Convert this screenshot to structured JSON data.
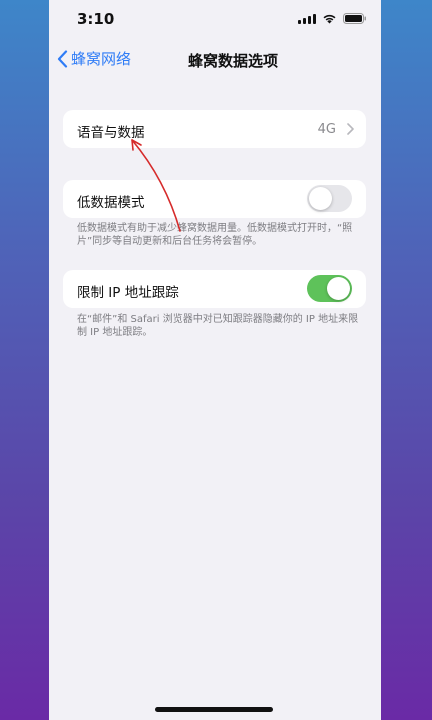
{
  "status_bar": {
    "time": "3:10"
  },
  "nav": {
    "back_label": "蜂窝网络",
    "title": "蜂窝数据选项"
  },
  "voice_data": {
    "label": "语音与数据",
    "value": "4G"
  },
  "low_data_mode": {
    "label": "低数据模式",
    "enabled": false,
    "footnote": "低数据模式有助于减少蜂窝数据用量。低数据模式打开时，“照片”同步等自动更新和后台任务将会暂停。"
  },
  "limit_ip_tracking": {
    "label": "限制 IP 地址跟踪",
    "enabled": true,
    "footnote": "在“邮件”和 Safari 浏览器中对已知跟踪器隐藏你的 IP 地址来限制 IP 地址跟踪。"
  },
  "colors": {
    "accent": "#2f7cf6",
    "toggle_on": "#5ec25a",
    "annotation": "#d62b2b"
  },
  "icons": [
    "back-chevron-icon",
    "chevron-right-icon",
    "signal-icon",
    "wifi-icon",
    "battery-icon"
  ]
}
